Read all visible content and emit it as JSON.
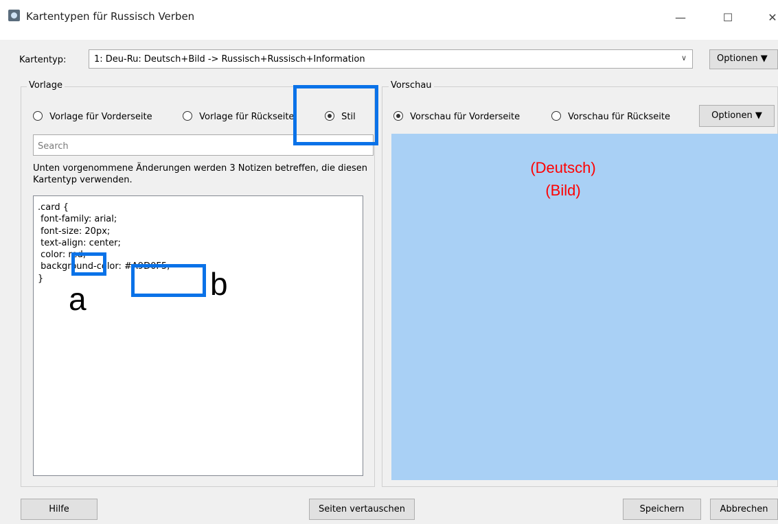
{
  "window": {
    "title": "Kartentypen für Russisch Verben",
    "controls": {
      "minimize": "—",
      "maximize": "☐",
      "close": "✕"
    }
  },
  "top": {
    "card_type_label": "Kartentyp:",
    "card_type_value": "1: Deu-Ru: Deutsch+Bild -> Russisch+Russisch+Information",
    "options_label": "Optionen ▼"
  },
  "template_group": {
    "title": "Vorlage",
    "radios": [
      {
        "label": "Vorlage für Vorderseite",
        "checked": false
      },
      {
        "label": "Vorlage für Rückseite",
        "checked": false
      },
      {
        "label": "Stil",
        "checked": true
      }
    ],
    "search_placeholder": "Search",
    "notice": "Unten vorgenommene Änderungen werden 3 Notizen betreffen, die diesen Kartentyp verwenden.",
    "code": ".card {\n font-family: arial;\n font-size: 20px;\n text-align: center;\n color: red;\n background-color: #A9D0F5;\n}"
  },
  "preview_group": {
    "title": "Vorschau",
    "radios": [
      {
        "label": "Vorschau für Vorderseite",
        "checked": true
      },
      {
        "label": "Vorschau für Rückseite",
        "checked": false
      }
    ],
    "options_label": "Optionen ▼",
    "preview_lines": [
      "(Deutsch)",
      "(Bild)"
    ]
  },
  "annotations": {
    "a": "a",
    "b": "b"
  },
  "bottom": {
    "help": "Hilfe",
    "swap": "Seiten vertauschen",
    "save": "Speichern",
    "cancel": "Abbrechen"
  },
  "colors": {
    "preview_bg": "#A9D0F5",
    "preview_text": "red",
    "highlight": "#0a72e8"
  }
}
